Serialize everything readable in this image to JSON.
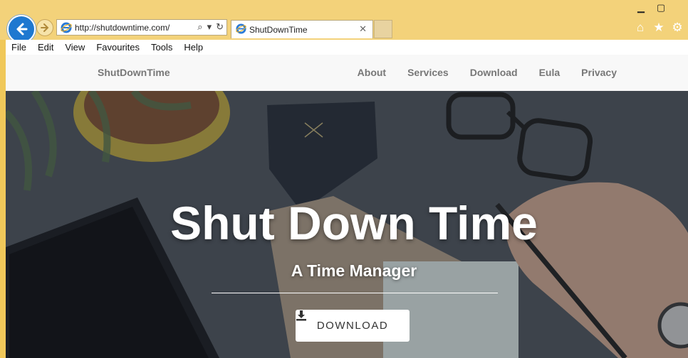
{
  "browser": {
    "address_url": "http://shutdowntime.com/",
    "tab_title": "ShutDownTime",
    "menu": [
      "File",
      "Edit",
      "View",
      "Favourites",
      "Tools",
      "Help"
    ]
  },
  "site": {
    "brand": "ShutDownTime",
    "nav": [
      "About",
      "Services",
      "Download",
      "Eula",
      "Privacy"
    ],
    "hero_title": "Shut Down Time",
    "hero_subtitle": "A Time Manager",
    "download_label": "DOWNLOAD"
  },
  "colors": {
    "chrome": "#f3d27a",
    "back_button": "#1e78d0",
    "hero_overlay": "#3f464d"
  }
}
